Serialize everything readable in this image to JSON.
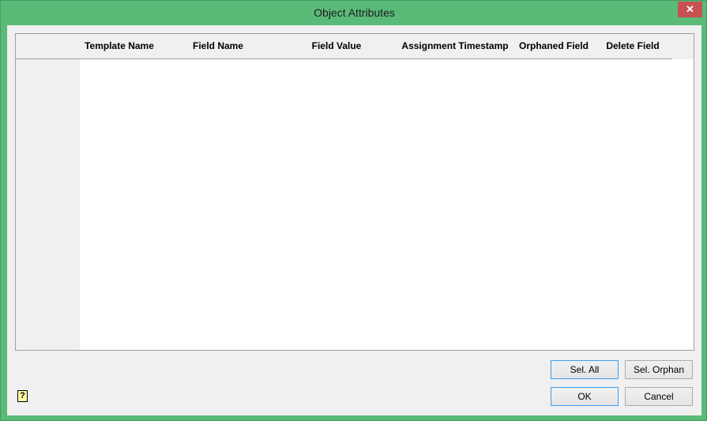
{
  "window": {
    "title": "Object Attributes",
    "close_label": "✕"
  },
  "grid": {
    "columns": [
      "Template Name",
      "Field Name",
      "Field Value",
      "Assignment Timestamp",
      "Orphaned Field",
      "Delete Field"
    ],
    "rows": []
  },
  "buttons": {
    "sel_all": "Sel. All",
    "sel_orphan": "Sel. Orphan",
    "ok": "OK",
    "cancel": "Cancel",
    "help": "?"
  }
}
